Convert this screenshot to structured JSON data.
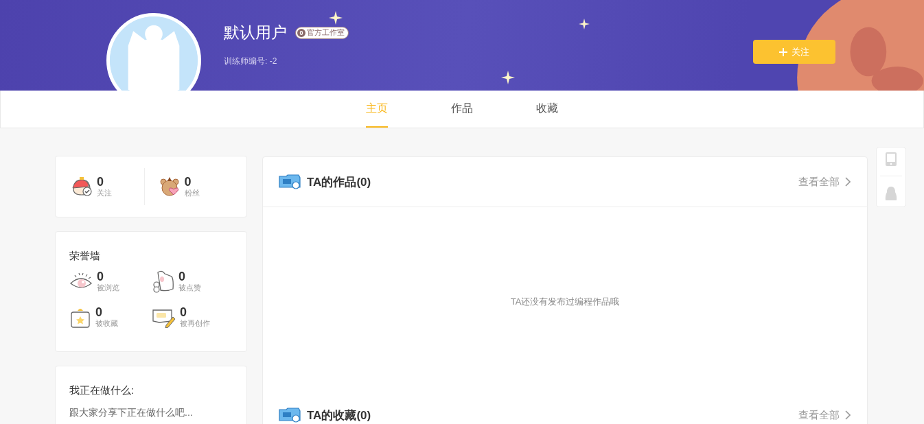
{
  "profile": {
    "name": "默认用户",
    "badge": {
      "count": "0",
      "label": "官方工作室"
    },
    "trainer_id": "训练师编号: -2",
    "follow_button": {
      "label": "关注"
    }
  },
  "tabs": [
    {
      "label": "主页",
      "selected": true
    },
    {
      "label": "作品",
      "selected": false
    },
    {
      "label": "收藏",
      "selected": false
    }
  ],
  "social_stats": [
    {
      "kind": "following",
      "count": "0",
      "label": "关注"
    },
    {
      "kind": "fans",
      "count": "0",
      "label": "粉丝"
    }
  ],
  "honor_wall": {
    "title": "荣誉墙",
    "items": [
      {
        "kind": "views",
        "count": "0",
        "label": "被浏览"
      },
      {
        "kind": "likes",
        "count": "0",
        "label": "被点赞"
      },
      {
        "kind": "favorites",
        "count": "0",
        "label": "被收藏"
      },
      {
        "kind": "remixes",
        "count": "0",
        "label": "被再创作"
      }
    ]
  },
  "status": {
    "title": "我正在做什么:",
    "placeholder": "跟大家分享下正在做什么吧..."
  },
  "sections": [
    {
      "title": "TA的作品(0)",
      "link": "查看全部",
      "empty_text": "TA还没有发布过编程作品哦"
    },
    {
      "title": "TA的收藏(0)",
      "link": "查看全部"
    }
  ]
}
